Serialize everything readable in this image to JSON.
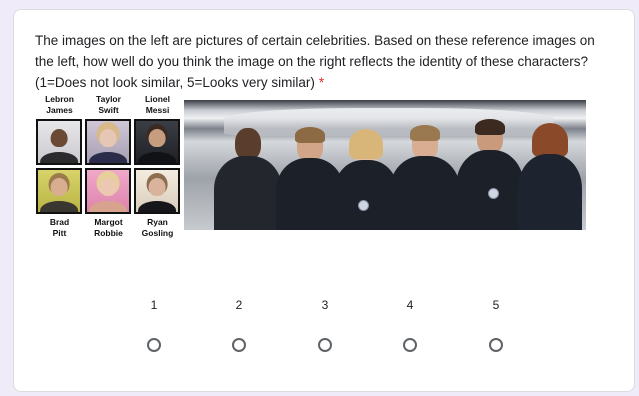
{
  "question": {
    "text": "The images on the left are pictures of certain celebrities. Based on these reference images on the left, how well do you think the image on the right reflects the identity of these characters? (1=Does not look similar, 5=Looks very similar)",
    "required_mark": "*"
  },
  "reference": {
    "top_names": [
      "Lebron\nJames",
      "Taylor\nSwift",
      "Lionel\nMessi"
    ],
    "bottom_names": [
      "Brad\nPitt",
      "Margot\nRobbie",
      "Ryan\nGosling"
    ]
  },
  "scale": {
    "options": [
      {
        "label": "1"
      },
      {
        "label": "2"
      },
      {
        "label": "3"
      },
      {
        "label": "4"
      },
      {
        "label": "5"
      }
    ]
  },
  "colors": {
    "background": "#f0ebf8",
    "required": "#d93025",
    "radio_border": "#5f6368"
  }
}
